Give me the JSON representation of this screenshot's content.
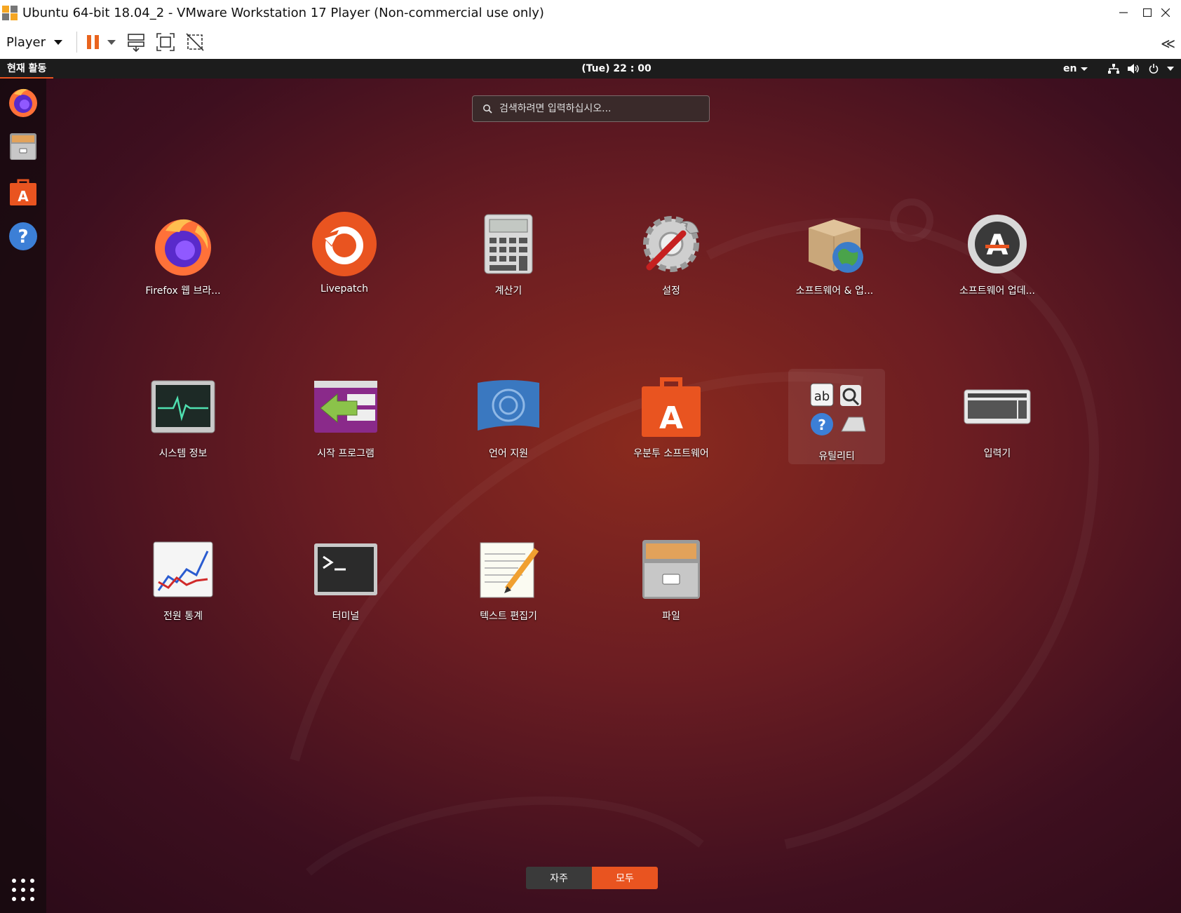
{
  "window": {
    "title": "Ubuntu 64-bit 18.04_2 - VMware Workstation 17 Player (Non-commercial use only)"
  },
  "toolbar": {
    "player_label": "Player"
  },
  "topbar": {
    "activities": "현재 활동",
    "clock": "(Tue) 22 : 00",
    "lang": "en"
  },
  "search": {
    "placeholder": "검색하려면 입력하십시오..."
  },
  "apps": [
    {
      "label": "Firefox 웹 브라...",
      "icon": "firefox-icon"
    },
    {
      "label": "Livepatch",
      "icon": "livepatch-icon"
    },
    {
      "label": "계산기",
      "icon": "calculator-icon"
    },
    {
      "label": "설정",
      "icon": "settings-icon"
    },
    {
      "label": "소프트웨어 & 업...",
      "icon": "software-updates-icon"
    },
    {
      "label": "소프트웨어 업데...",
      "icon": "software-updater-icon"
    },
    {
      "label": "시스템 정보",
      "icon": "system-monitor-icon"
    },
    {
      "label": "시작 프로그램",
      "icon": "startup-apps-icon"
    },
    {
      "label": "언어 지원",
      "icon": "language-support-icon"
    },
    {
      "label": "우분투 소프트웨어",
      "icon": "ubuntu-software-icon"
    },
    {
      "label": "유틸리티",
      "icon": "utilities-folder-icon"
    },
    {
      "label": "입력기",
      "icon": "keyboard-input-icon"
    },
    {
      "label": "전원 통계",
      "icon": "power-statistics-icon"
    },
    {
      "label": "터미널",
      "icon": "terminal-icon"
    },
    {
      "label": "텍스트 편집기",
      "icon": "text-editor-icon"
    },
    {
      "label": "파일",
      "icon": "files-icon"
    }
  ],
  "tabs": {
    "frequent": "자주",
    "all": "모두"
  },
  "colors": {
    "accent": "#e95420",
    "topbar": "#1c1c1c"
  }
}
